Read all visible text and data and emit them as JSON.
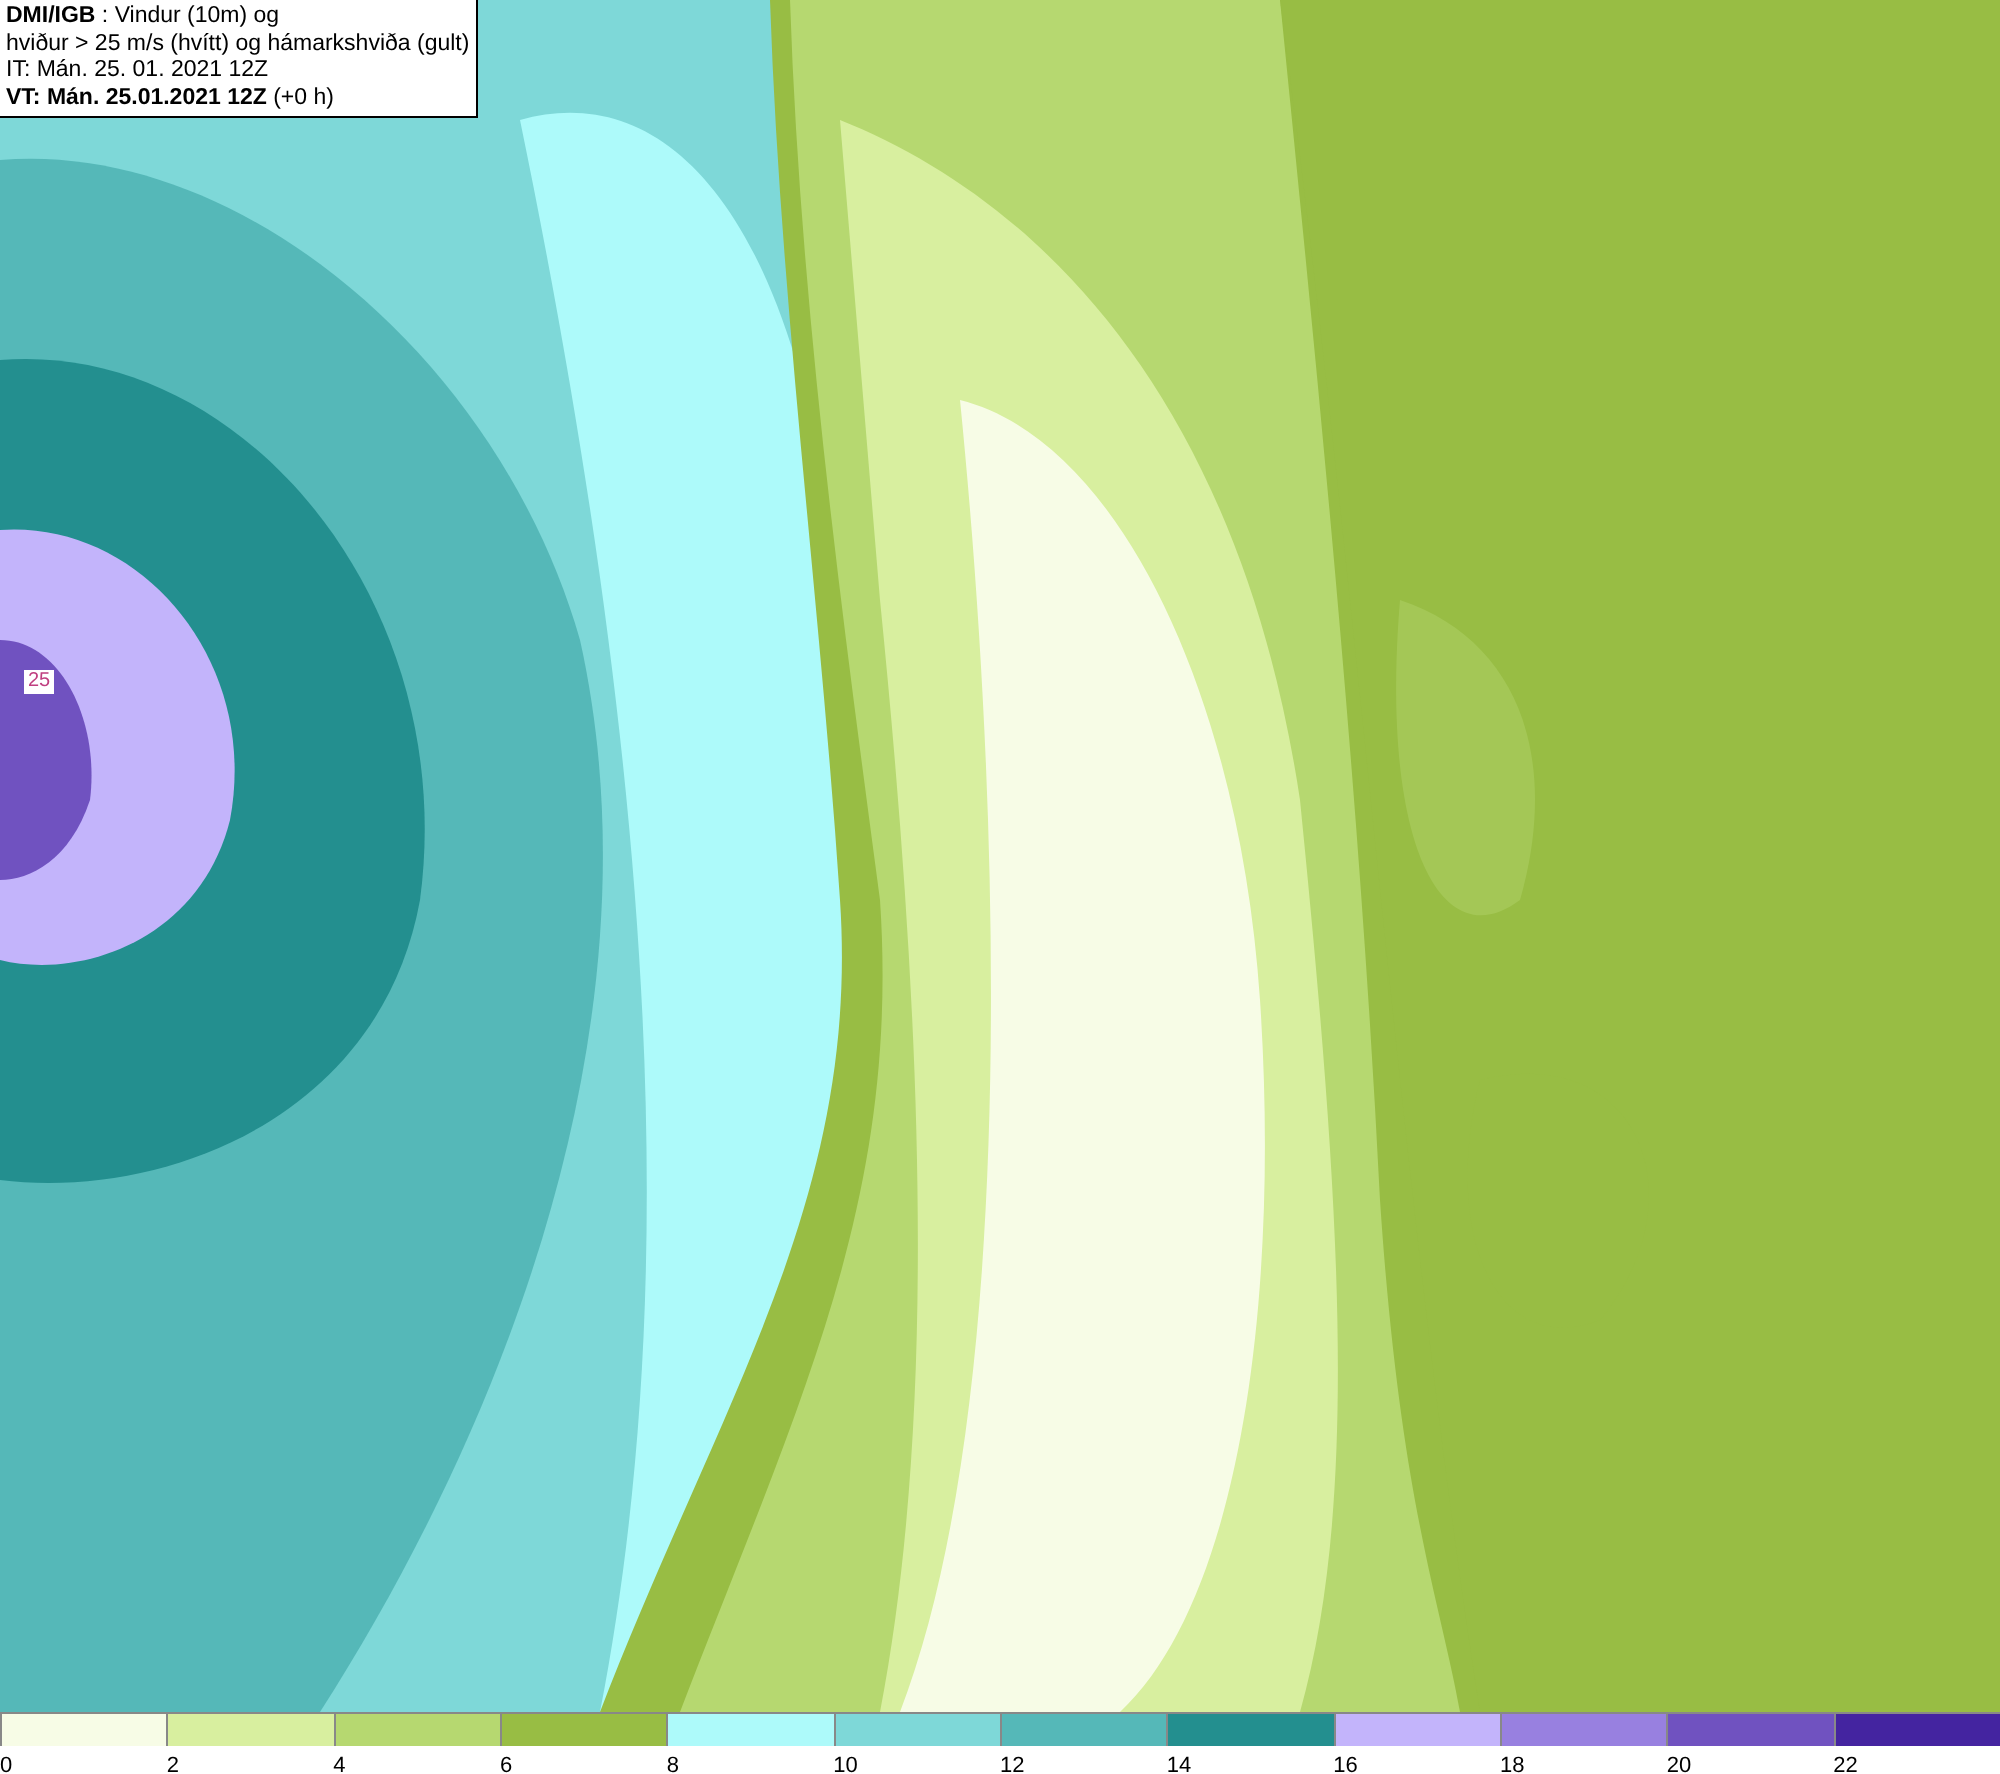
{
  "header": {
    "lines": [
      "**DMI/IGB** : Vindur (10m) og",
      "hviður > 25 m/s (hvítt) og hámarkshviða (gult)",
      "IT: Mán. 25. 01. 2021 12Z",
      "**VT: Mán. 25.01.2021 12Z** (+0 h)"
    ]
  },
  "map": {
    "contour_label": "25"
  },
  "legend": [
    {
      "label": "0",
      "color": "#f7fce6"
    },
    {
      "label": "2",
      "color": "#d8ef9f"
    },
    {
      "label": "4",
      "color": "#b6d870"
    },
    {
      "label": "6",
      "color": "#98bd44"
    },
    {
      "label": "8",
      "color": "#adfafa"
    },
    {
      "label": "10",
      "color": "#7ed8d8"
    },
    {
      "label": "12",
      "color": "#55b8b8"
    },
    {
      "label": "14",
      "color": "#238f8f"
    },
    {
      "label": "16",
      "color": "#c3b4fb"
    },
    {
      "label": "18",
      "color": "#9880e0"
    },
    {
      "label": "20",
      "color": "#7052c0"
    },
    {
      "label": "22",
      "color": "#4424a0"
    }
  ]
}
